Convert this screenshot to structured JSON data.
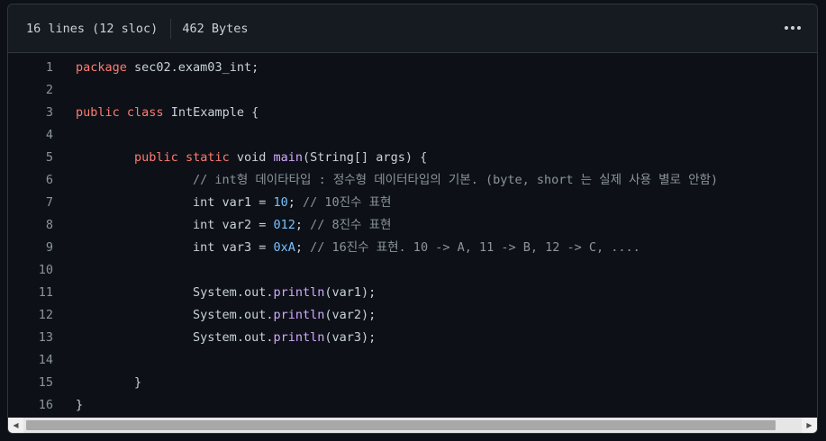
{
  "header": {
    "lines_info": "16 lines (12 sloc)",
    "size_info": "462 Bytes"
  },
  "code": {
    "lines": [
      {
        "num": "1",
        "tokens": [
          {
            "t": "package",
            "c": "kw"
          },
          {
            "t": " sec02.exam03_int;",
            "c": ""
          }
        ]
      },
      {
        "num": "2",
        "tokens": []
      },
      {
        "num": "3",
        "tokens": [
          {
            "t": "public",
            "c": "kw"
          },
          {
            "t": " ",
            "c": ""
          },
          {
            "t": "class",
            "c": "kw"
          },
          {
            "t": " IntExample {",
            "c": ""
          }
        ]
      },
      {
        "num": "4",
        "tokens": []
      },
      {
        "num": "5",
        "tokens": [
          {
            "t": "\t",
            "c": ""
          },
          {
            "t": "public",
            "c": "kw"
          },
          {
            "t": " ",
            "c": ""
          },
          {
            "t": "static",
            "c": "kw"
          },
          {
            "t": " void ",
            "c": ""
          },
          {
            "t": "main",
            "c": "fn"
          },
          {
            "t": "(String[] args) {",
            "c": ""
          }
        ]
      },
      {
        "num": "6",
        "tokens": [
          {
            "t": "\t\t",
            "c": ""
          },
          {
            "t": "// int형 데이타타입 : 정수형 데이터타입의 기본. (byte, short 는 실제 사용 별로 안함)",
            "c": "cm"
          }
        ]
      },
      {
        "num": "7",
        "tokens": [
          {
            "t": "\t\t",
            "c": ""
          },
          {
            "t": "int var1 = ",
            "c": ""
          },
          {
            "t": "10",
            "c": "num"
          },
          {
            "t": "; ",
            "c": ""
          },
          {
            "t": "// 10진수 표현",
            "c": "cm"
          }
        ]
      },
      {
        "num": "8",
        "tokens": [
          {
            "t": "\t\t",
            "c": ""
          },
          {
            "t": "int var2 = ",
            "c": ""
          },
          {
            "t": "012",
            "c": "num"
          },
          {
            "t": "; ",
            "c": ""
          },
          {
            "t": "// 8진수 표현",
            "c": "cm"
          }
        ]
      },
      {
        "num": "9",
        "tokens": [
          {
            "t": "\t\t",
            "c": ""
          },
          {
            "t": "int var3 = ",
            "c": ""
          },
          {
            "t": "0xA",
            "c": "num"
          },
          {
            "t": "; ",
            "c": ""
          },
          {
            "t": "// 16진수 표현. 10 -> A, 11 -> B, 12 -> C, ....",
            "c": "cm"
          }
        ]
      },
      {
        "num": "10",
        "tokens": []
      },
      {
        "num": "11",
        "tokens": [
          {
            "t": "\t\t",
            "c": ""
          },
          {
            "t": "System.out.",
            "c": ""
          },
          {
            "t": "println",
            "c": "fn"
          },
          {
            "t": "(var1);",
            "c": ""
          }
        ]
      },
      {
        "num": "12",
        "tokens": [
          {
            "t": "\t\t",
            "c": ""
          },
          {
            "t": "System.out.",
            "c": ""
          },
          {
            "t": "println",
            "c": "fn"
          },
          {
            "t": "(var2);",
            "c": ""
          }
        ]
      },
      {
        "num": "13",
        "tokens": [
          {
            "t": "\t\t",
            "c": ""
          },
          {
            "t": "System.out.",
            "c": ""
          },
          {
            "t": "println",
            "c": "fn"
          },
          {
            "t": "(var3);",
            "c": ""
          }
        ]
      },
      {
        "num": "14",
        "tokens": []
      },
      {
        "num": "15",
        "tokens": [
          {
            "t": "\t",
            "c": ""
          },
          {
            "t": "}",
            "c": ""
          }
        ]
      },
      {
        "num": "16",
        "tokens": [
          {
            "t": "}",
            "c": ""
          }
        ]
      }
    ]
  },
  "scrollbar": {
    "left_arrow_icon": "scroll-left-icon",
    "right_arrow_icon": "scroll-right-icon",
    "thumb_fraction": 0.97
  }
}
